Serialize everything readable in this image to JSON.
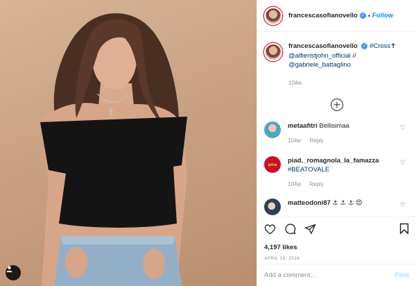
{
  "photo": {
    "alt_icon": "user-tag-icon"
  },
  "header": {
    "username": "francescasofianovello",
    "separator": "•",
    "follow_label": "Follow"
  },
  "caption": {
    "username": "francescasofianovello",
    "hashtag": "#Cross",
    "emoji": "✝",
    "mention1": "@alfieristjohn_official",
    "separator": " // ",
    "mention2": "@gabriele_battaglino",
    "time": "104w"
  },
  "comments": [
    {
      "username": "metaafitri",
      "text": "Bellisimaa",
      "time": "104w",
      "reply": "Reply"
    },
    {
      "username": "piad._romagnola_la_famazza",
      "text": "#BEATOVALE",
      "time": "104w",
      "reply": "Reply"
    },
    {
      "username": "matteodoni87",
      "text": "⚓ ⚓ ⚓ 😍"
    }
  ],
  "actions": {
    "likes": "4,197 likes",
    "date": "APRIL 18, 2018"
  },
  "composer": {
    "placeholder": "Add a comment...",
    "post_label": "Post"
  },
  "colors": {
    "accent": "#0095f6",
    "verified": "#3897f0",
    "post_disabled": "#b2dffc",
    "muted": "#8e8e8e"
  }
}
